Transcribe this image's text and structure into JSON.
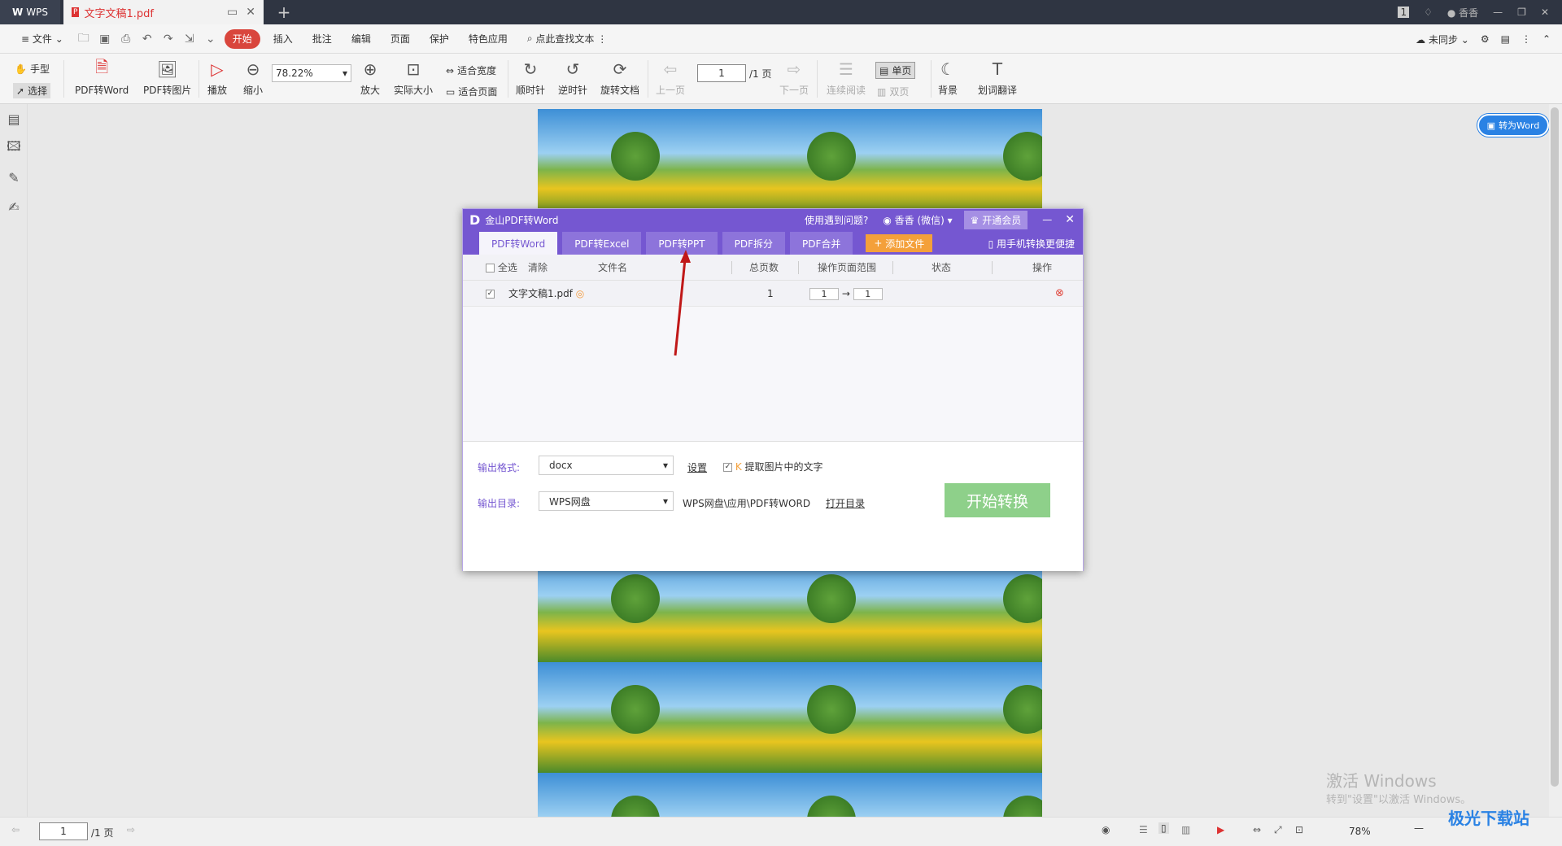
{
  "titlebar": {
    "app_name": "WPS",
    "tab_title": "文字文稿1.pdf",
    "user": "香香"
  },
  "menu": {
    "file": "文件",
    "items": [
      "开始",
      "插入",
      "批注",
      "编辑",
      "页面",
      "保护",
      "特色应用"
    ],
    "search": "点此查找文本",
    "sync": "未同步"
  },
  "toolbar": {
    "hand": "手型",
    "select": "选择",
    "pdf_word": "PDF转Word",
    "pdf_img": "PDF转图片",
    "play": "播放",
    "zoom_out": "缩小",
    "zoom_value": "78.22%",
    "zoom_in": "放大",
    "actual": "实际大小",
    "fit_width": "适合宽度",
    "fit_page": "适合页面",
    "cw": "顺时针",
    "ccw": "逆时针",
    "rotate": "旋转文档",
    "prev": "上一页",
    "page_value": "1",
    "page_total": "/1 页",
    "next": "下一页",
    "continuous": "连续阅读",
    "single": "单页",
    "double": "双页",
    "bg": "背景",
    "translate": "划词翻译"
  },
  "side": {
    "to_word": "转为Word"
  },
  "dialog": {
    "title": "金山PDF转Word",
    "help": "使用遇到问题?",
    "user": "香香 (微信)",
    "vip": "开通会员",
    "tabs": [
      "PDF转Word",
      "PDF转Excel",
      "PDF转PPT",
      "PDF拆分",
      "PDF合并"
    ],
    "add_file": "添加文件",
    "mobile": "用手机转换更便捷",
    "headers": {
      "select_all": "全选",
      "clear": "清除",
      "filename": "文件名",
      "pages": "总页数",
      "range": "操作页面范围",
      "status": "状态",
      "op": "操作"
    },
    "rows": [
      {
        "file": "文字文稿1.pdf",
        "pages": "1",
        "from": "1",
        "to": "1"
      }
    ],
    "format_label": "输出格式:",
    "format_value": "docx",
    "settings": "设置",
    "extract": "提取图片中的文字",
    "dir_label": "输出目录:",
    "dir_value": "WPS网盘",
    "dir_path": "WPS网盘\\应用\\PDF转WORD",
    "open_dir": "打开目录",
    "start": "开始转换"
  },
  "status": {
    "page_value": "1",
    "page_total": "/1 页",
    "zoom": "78%"
  },
  "watermark": {
    "line1": "激活 Windows",
    "line2": "转到\"设置\"以激活 Windows。",
    "logo": "极光下载站"
  },
  "colors": {
    "dialog": "#7557d1",
    "start": "#8ed08a",
    "accent": "#d9463d"
  }
}
